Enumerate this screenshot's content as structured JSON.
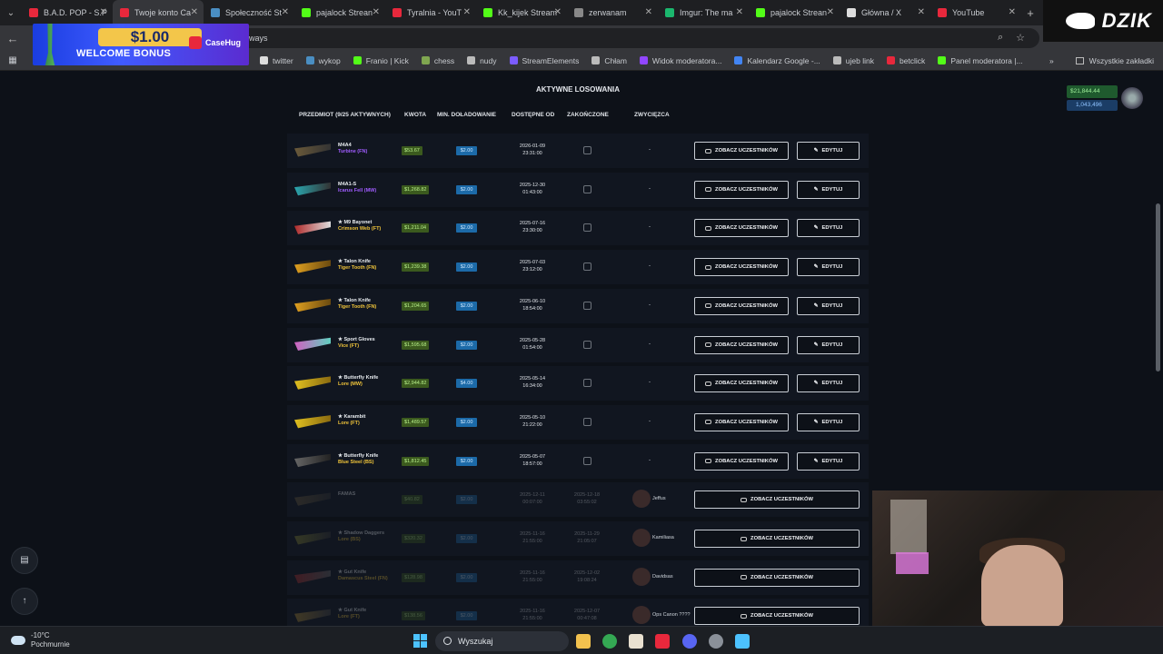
{
  "browser": {
    "tabs": [
      {
        "title": "B.A.D. POP - S.P",
        "color": "#e8283c"
      },
      {
        "title": "Twoje konto Ca",
        "color": "#e8283c",
        "active": true
      },
      {
        "title": "Społeczność St",
        "color": "#4a8ec2"
      },
      {
        "title": "pajalock Strean",
        "color": "#53fc18"
      },
      {
        "title": "Tyralnia - YouT",
        "color": "#e8283c"
      },
      {
        "title": "Kk_kijek Stream",
        "color": "#53fc18"
      },
      {
        "title": "zerwanam",
        "color": "#888888"
      },
      {
        "title": "Imgur: The ma",
        "color": "#1bb76e"
      },
      {
        "title": "pajalock Strean",
        "color": "#53fc18"
      },
      {
        "title": "Główna / X",
        "color": "#dddddd"
      },
      {
        "title": "YouTube",
        "color": "#e8283c"
      }
    ],
    "new_tab": "+",
    "url_fragment": "ways",
    "bookmarks": [
      {
        "label": "twitter",
        "color": "#dddddd"
      },
      {
        "label": "wykop",
        "color": "#4a8ec2"
      },
      {
        "label": "Franio | Kick",
        "color": "#53fc18"
      },
      {
        "label": "chess",
        "color": "#7fa650"
      },
      {
        "label": "nudy",
        "color": "#bbbbbb"
      },
      {
        "label": "StreamElements",
        "color": "#7b5cff"
      },
      {
        "label": "Chłam",
        "color": "#bbbbbb"
      },
      {
        "label": "Widok moderatora...",
        "color": "#9146ff"
      },
      {
        "label": "Kalendarz Google -...",
        "color": "#4285f4"
      },
      {
        "label": "ujeb link",
        "color": "#bbbbbb"
      },
      {
        "label": "betclick",
        "color": "#e8283c"
      },
      {
        "label": "Panel moderatora |...",
        "color": "#53fc18"
      }
    ],
    "all_bookmarks": "Wszystkie zakładki"
  },
  "ad": {
    "amount": "$1.00",
    "text": "WELCOME BONUS",
    "brand": "CaseHug"
  },
  "overlay": {
    "logo": "DZIK"
  },
  "account": {
    "balance": "$21,844.44",
    "coins": "1,043,496"
  },
  "page": {
    "heading": "AKTYWNE LOSOWANIA",
    "columns": [
      "PRZEDMIOT (9/25 AKTYWNYCH)",
      "KWOTA",
      "MIN. DOŁADOWANIE",
      "DOSTĘPNE OD",
      "ZAKOŃCZONE",
      "ZWYCIĘZCA"
    ],
    "btn_participants": "ZOBACZ UCZESTNIKÓW",
    "btn_edit": "EDYTUJ",
    "rows": [
      {
        "name": "M4A4",
        "skin": "Turbine (FN)",
        "skin_color": "#a05cff",
        "amount": "$53.67",
        "min": "$2.00",
        "date": "2026-01-09",
        "time": "23:31:00",
        "winner": "-",
        "active": true
      },
      {
        "name": "M4A1-S",
        "skin": "Icarus Fell (MW)",
        "skin_color": "#a05cff",
        "amount": "$1,268.82",
        "min": "$2.00",
        "date": "2025-12-30",
        "time": "01:43:00",
        "winner": "-",
        "active": true
      },
      {
        "name": "★ M9 Bayonet",
        "skin": "Crimson Web (FT)",
        "skin_color": "#f0c43a",
        "amount": "$1,211.04",
        "min": "$2.00",
        "date": "2025-07-16",
        "time": "23:30:00",
        "winner": "-",
        "active": true
      },
      {
        "name": "★ Talon Knife",
        "skin": "Tiger Tooth (FN)",
        "skin_color": "#f0c43a",
        "amount": "$1,239.38",
        "min": "$2.00",
        "date": "2025-07-03",
        "time": "23:12:00",
        "winner": "-",
        "active": true
      },
      {
        "name": "★ Talon Knife",
        "skin": "Tiger Tooth (FN)",
        "skin_color": "#f0c43a",
        "amount": "$1,204.65",
        "min": "$2.00",
        "date": "2025-06-10",
        "time": "18:54:00",
        "winner": "-",
        "active": true
      },
      {
        "name": "★ Sport Gloves",
        "skin": "Vice (FT)",
        "skin_color": "#f0c43a",
        "amount": "$1,595.68",
        "min": "$2.00",
        "date": "2025-05-28",
        "time": "01:54:00",
        "winner": "-",
        "active": true
      },
      {
        "name": "★ Butterfly Knife",
        "skin": "Lore (MW)",
        "skin_color": "#f0c43a",
        "amount": "$2,944.82",
        "min": "$4.00",
        "date": "2025-05-14",
        "time": "16:34:00",
        "winner": "-",
        "active": true
      },
      {
        "name": "★ Karambit",
        "skin": "Lore (FT)",
        "skin_color": "#f0c43a",
        "amount": "$1,489.57",
        "min": "$2.00",
        "date": "2025-05-10",
        "time": "21:22:00",
        "winner": "-",
        "active": true
      },
      {
        "name": "★ Butterfly Knife",
        "skin": "Blue Steel (BS)",
        "skin_color": "#f0c43a",
        "amount": "$1,812.45",
        "min": "$2.00",
        "date": "2025-05-07",
        "time": "18:57:00",
        "winner": "-",
        "active": true
      },
      {
        "name": "FAMAS",
        "skin": "",
        "skin_color": "#a05cff",
        "amount": "$40.82",
        "min": "$2.00",
        "date": "2025-12-11",
        "time": "00:07:00",
        "end_date": "2025-12-18",
        "end_time": "03:55:02",
        "winner": "Jeffus",
        "active": false
      },
      {
        "name": "★ Shadow Daggers",
        "skin": "Lore (BS)",
        "skin_color": "#f0c43a",
        "amount": "$320.32",
        "min": "$2.00",
        "date": "2025-11-16",
        "time": "21:55:00",
        "end_date": "2025-11-29",
        "end_time": "21:05:07",
        "winner": "Kamiliasa",
        "active": false
      },
      {
        "name": "★ Gut Knife",
        "skin": "Damascus Steel (FN)",
        "skin_color": "#f0c43a",
        "amount": "$128.98",
        "min": "$2.00",
        "date": "2025-11-16",
        "time": "21:55:00",
        "end_date": "2025-12-02",
        "end_time": "19:08:24",
        "winner": "Davidsas",
        "active": false
      },
      {
        "name": "★ Gut Knife",
        "skin": "Lore (FT)",
        "skin_color": "#f0c43a",
        "amount": "$138.56",
        "min": "$2.00",
        "date": "2025-11-16",
        "time": "21:55:00",
        "end_date": "2025-12-07",
        "end_time": "00:47:08",
        "winner": "Ops Canon ????",
        "active": false
      }
    ]
  },
  "taskbar": {
    "temp": "-10°C",
    "weather": "Pochmurnie",
    "search": "Wyszukaj"
  }
}
